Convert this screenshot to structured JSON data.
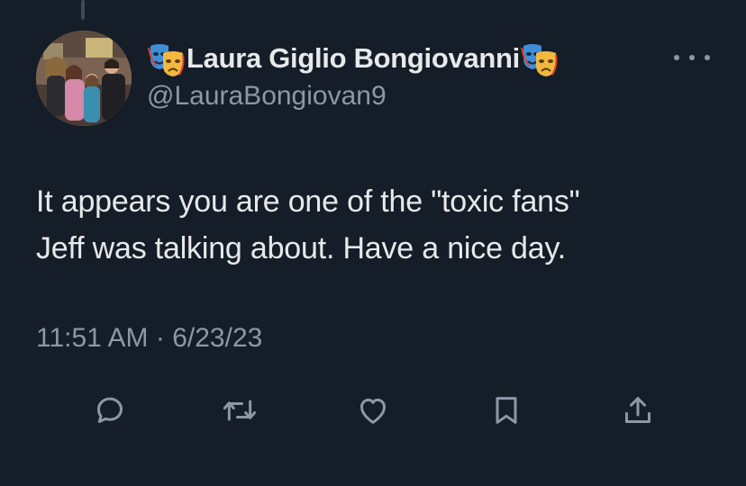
{
  "tweet": {
    "author": {
      "name": "Laura Giglio Bongiovanni",
      "handle": "@LauraBongiovan9",
      "name_emoji": "performing-arts-masks"
    },
    "text_lines": [
      "It appears you are one of the \"toxic fans\"",
      "Jeff was talking about. Have a nice day."
    ],
    "time": "11:51 AM",
    "separator": "·",
    "date": "6/23/23"
  },
  "actions": [
    "reply",
    "retweet",
    "like",
    "bookmark",
    "share"
  ],
  "colors": {
    "background": "#151d28",
    "text_primary": "#e7e9ea",
    "text_secondary": "#8b98a5",
    "thread_line": "#3e4953"
  }
}
